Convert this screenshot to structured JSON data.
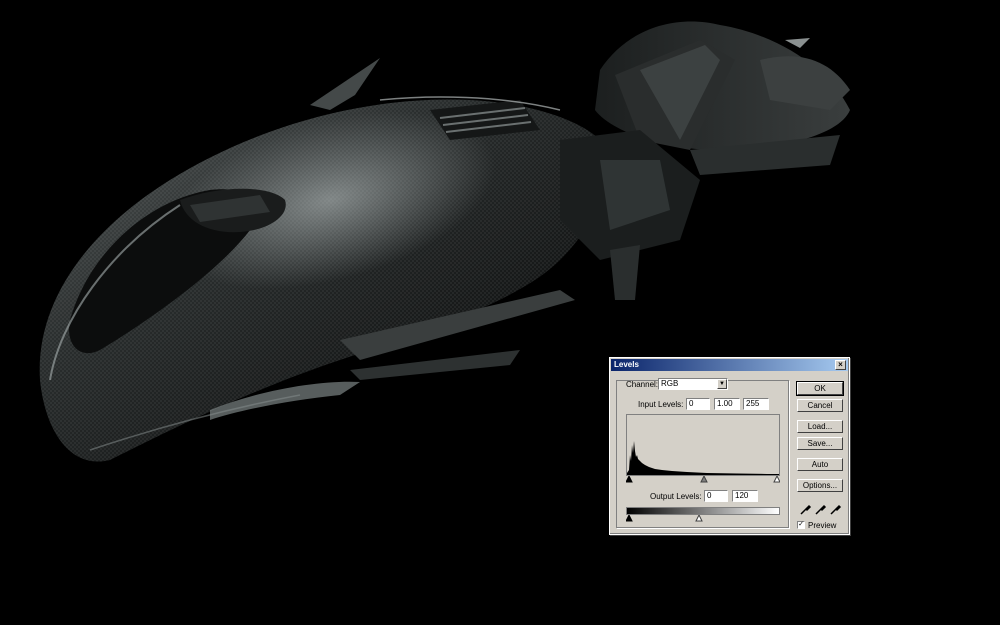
{
  "dialog": {
    "title": "Levels",
    "close_glyph": "×",
    "channel_label": "Channel:",
    "channel_value": "RGB",
    "input_levels_label": "Input Levels:",
    "input_black": "0",
    "input_gamma": "1.00",
    "input_white": "255",
    "output_levels_label": "Output Levels:",
    "output_black": "0",
    "output_white": "120",
    "buttons": {
      "ok": "OK",
      "cancel": "Cancel",
      "load": "Load...",
      "save": "Save...",
      "auto": "Auto",
      "options": "Options..."
    },
    "preview_label": "Preview",
    "preview_checked": "✓"
  },
  "icons": {
    "black_eyedropper": "eyedropper-black-icon",
    "gray_eyedropper": "eyedropper-gray-icon",
    "white_eyedropper": "eyedropper-white-icon"
  },
  "colors": {
    "dialog_bg": "#d4d0c8",
    "title_start": "#0a246a",
    "title_end": "#a6caf0"
  }
}
